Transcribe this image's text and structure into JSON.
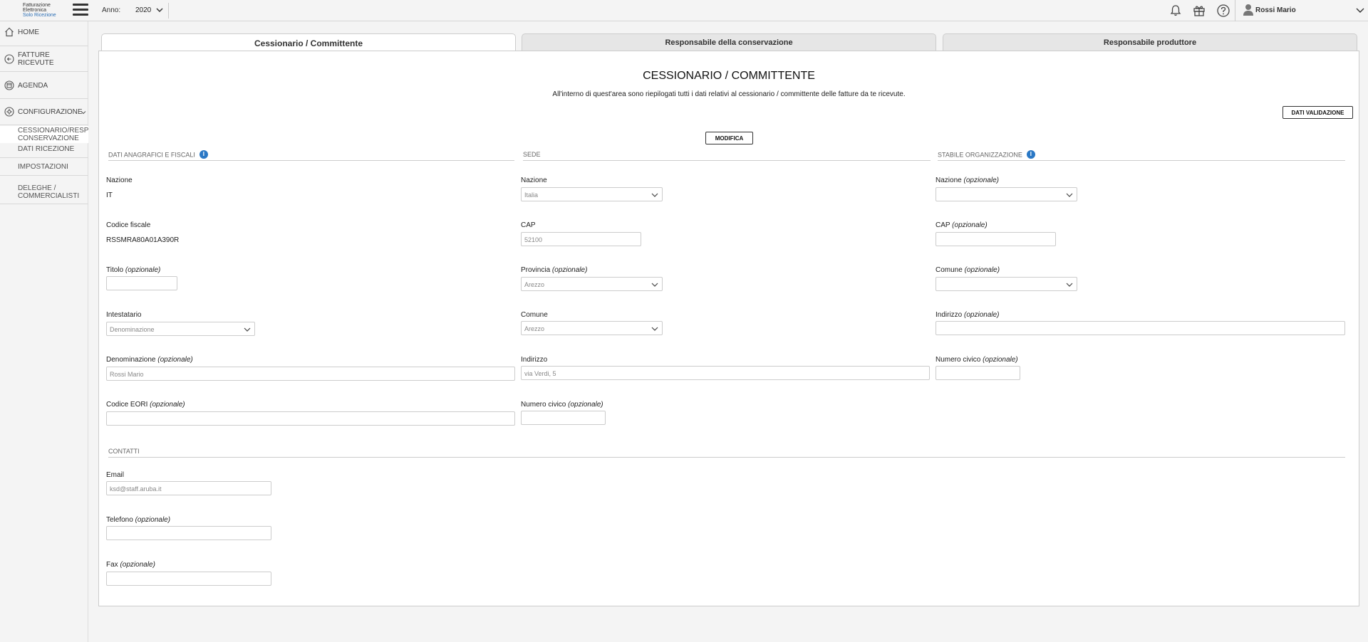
{
  "header": {
    "logo": {
      "line1": "Fatturazione",
      "line2": "Elettronica",
      "line3": "Solo Ricezione"
    },
    "year_label": "Anno:",
    "year_value": "2020",
    "user_name": "Rossi Mario"
  },
  "sidebar": {
    "items": [
      {
        "label": "HOME"
      },
      {
        "label": "FATTURE RICEVUTE"
      },
      {
        "label": "AGENDA"
      },
      {
        "label": "CONFIGURAZIONE"
      }
    ],
    "sub_items": [
      {
        "label": "CESSIONARIO/RESP CONSERVAZIONE"
      },
      {
        "label": "DATI RICEZIONE"
      },
      {
        "label": "IMPOSTAZIONI"
      },
      {
        "label": "DELEGHE / COMMERCIALISTI"
      }
    ]
  },
  "tabs": [
    {
      "label": "Cessionario / Committente"
    },
    {
      "label": "Responsabile della conservazione"
    },
    {
      "label": "Responsabile produttore"
    }
  ],
  "main": {
    "title": "CESSIONARIO / COMMITTENTE",
    "description": "All'interno di quest'area sono riepilogati tutti i dati relativi al cessionario / committente delle fatture da te ricevute.",
    "btn_validazione": "DATI VALIDAZIONE",
    "btn_modifica": "MODIFICA"
  },
  "opt": "(opzionale)",
  "sections": {
    "anagrafici": {
      "title": "DATI ANAGRAFICI E FISCALI",
      "nazione_label": "Nazione",
      "nazione_value": "IT",
      "cf_label": "Codice fiscale",
      "cf_value": "RSSMRA80A01A390R",
      "titolo_label": "Titolo",
      "intestatario_label": "Intestatario",
      "intestatario_value": "Denominazione",
      "denominazione_label": "Denominazione",
      "denominazione_value": "Rossi Mario",
      "eori_label": "Codice EORI"
    },
    "sede": {
      "title": "SEDE",
      "nazione_label": "Nazione",
      "nazione_value": "Italia",
      "cap_label": "CAP",
      "cap_value": "52100",
      "provincia_label": "Provincia",
      "provincia_value": "Arezzo",
      "comune_label": "Comune",
      "comune_value": "Arezzo",
      "indirizzo_label": "Indirizzo",
      "indirizzo_value": "via Verdi, 5",
      "civico_label": "Numero civico"
    },
    "stabile": {
      "title": "STABILE ORGANIZZAZIONE",
      "nazione_label": "Nazione",
      "cap_label": "CAP",
      "comune_label": "Comune",
      "indirizzo_label": "Indirizzo",
      "civico_label": "Numero civico"
    },
    "contatti": {
      "title": "CONTATTI",
      "email_label": "Email",
      "email_value": "ksd@staff.aruba.it",
      "telefono_label": "Telefono",
      "fax_label": "Fax"
    }
  },
  "colors": {
    "accent": "#2a78c5",
    "background": "#f4f4f4",
    "panel": "#ffffff"
  }
}
